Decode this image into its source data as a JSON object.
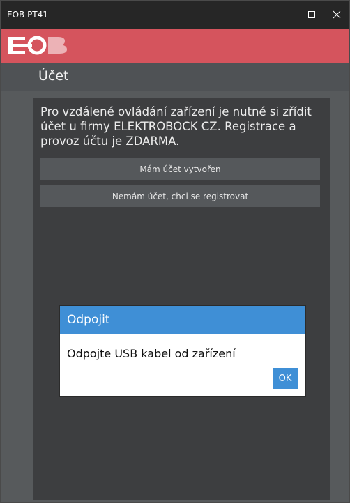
{
  "window": {
    "title": "EOB PT41"
  },
  "brand": {
    "logo_text": "EOB",
    "accent_color": "#d5545d"
  },
  "header": {
    "title": "Účet"
  },
  "main": {
    "intro": "Pro vzdálené ovládání zařízení je nutné si zřídit účet u firmy ELEKTROBOCK CZ. Registrace a provoz účtu je ZDARMA.",
    "button_have_account": "Mám účet vytvořen",
    "button_register": "Nemám účet, chci se registrovat"
  },
  "dialog": {
    "title": "Odpojit",
    "message": "Odpojte USB kabel od zařízení",
    "ok_label": "OK",
    "accent_color": "#3f8fd6"
  },
  "icons": {
    "minimize": "minimize-icon",
    "maximize": "maximize-icon",
    "close": "close-icon"
  }
}
